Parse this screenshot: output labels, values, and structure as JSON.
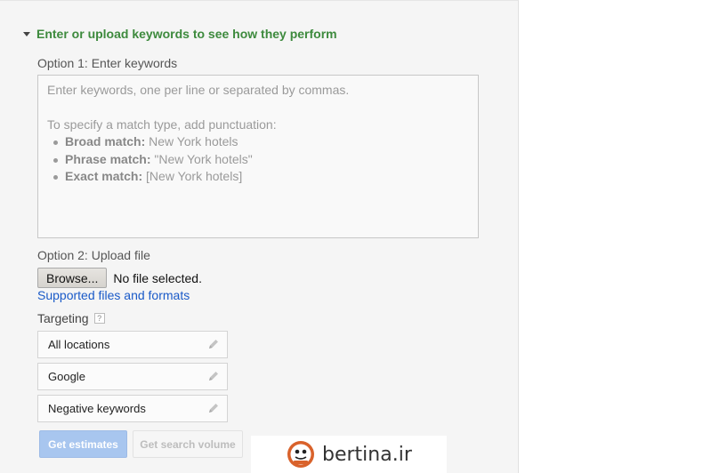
{
  "section": {
    "title": "Enter or upload keywords to see how they perform"
  },
  "option1": {
    "label": "Option 1: Enter keywords",
    "placeholder_line1": "Enter keywords, one per line or separated by commas.",
    "placeholder_line2": "To specify a match type, add punctuation:",
    "match_types": [
      {
        "name": "Broad match:",
        "example": "New York hotels"
      },
      {
        "name": "Phrase match:",
        "example": "\"New York hotels\""
      },
      {
        "name": "Exact match:",
        "example": "[New York hotels]"
      }
    ]
  },
  "option2": {
    "label": "Option 2: Upload file",
    "browse_label": "Browse...",
    "file_status": "No file selected.",
    "supported_link": "Supported files and formats"
  },
  "targeting": {
    "label": "Targeting",
    "help": "?",
    "items": [
      "All locations",
      "Google",
      "Negative keywords"
    ]
  },
  "actions": {
    "get_estimates": "Get estimates",
    "get_search_volume": "Get search volume"
  },
  "watermark": {
    "text": "bertina.ir",
    "logo_text": "BERTINA"
  },
  "colors": {
    "section_title": "#3d8a3d",
    "link": "#1a5ac8",
    "primary_button": "#a8c6ef",
    "panel_bg": "#f5f5f5"
  }
}
